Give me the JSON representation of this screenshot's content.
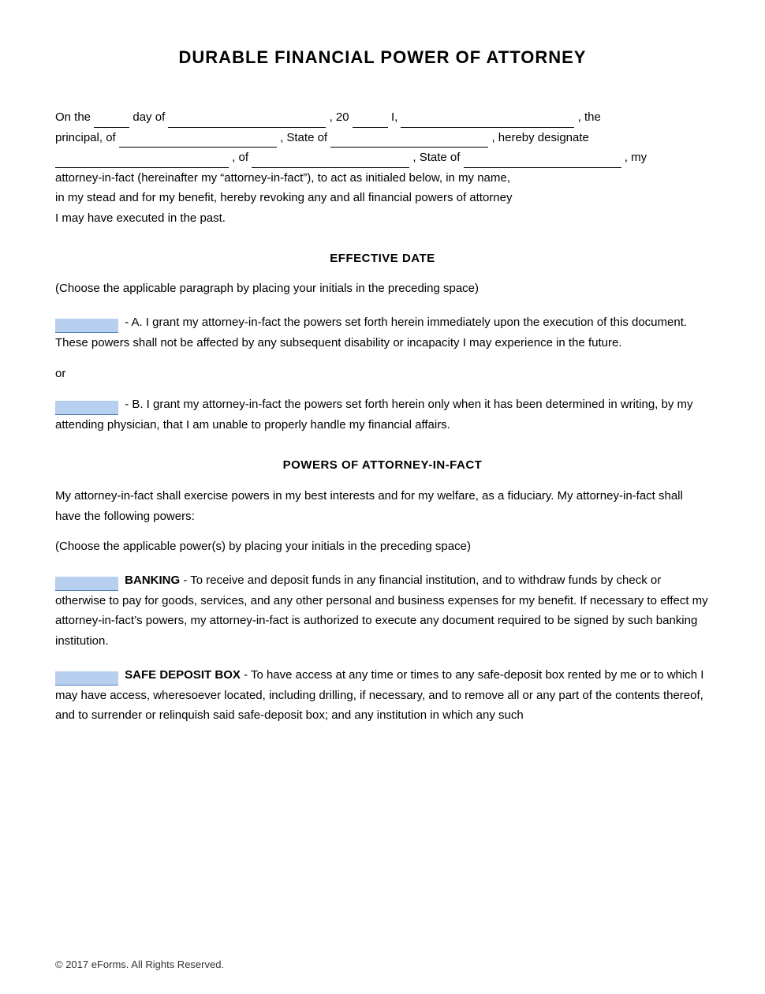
{
  "document": {
    "title": "DURABLE FINANCIAL POWER OF ATTORNEY",
    "intro": {
      "line1_prefix": "On the",
      "day_of": "day of",
      "year_prefix": ", 20",
      "I_prefix": "I,",
      "the_principal": ", the",
      "principal_of": "principal, of",
      "state_of_1": ", State of",
      "hereby_designate": ", hereby designate",
      "of_2": ", of",
      "state_of_2": ", State of",
      "my_text": ", my",
      "attorney_text": "attorney-in-fact (hereinafter my “attorney-in-fact”), to act as initialed below, in my name,",
      "stead_text": "in my stead and for my benefit, hereby revoking any and all financial powers of attorney",
      "past_text": "I may have executed in the past."
    },
    "effective_date": {
      "heading": "EFFECTIVE DATE",
      "choose_note": "(Choose the applicable paragraph by placing your initials in the preceding space)",
      "option_a": "- A. I grant my attorney-in-fact the powers set forth herein immediately upon the execution of this document. These powers shall not be affected by any subsequent disability or incapacity I may experience in the future.",
      "or_text": "or",
      "option_b": "- B. I grant my attorney-in-fact the powers set forth herein only when it has been determined in writing, by my attending physician, that I am unable to properly handle my financial affairs."
    },
    "powers_section": {
      "heading": "POWERS OF ATTORNEY-IN-FACT",
      "intro1": "My attorney-in-fact shall exercise powers in my best interests and for my welfare, as a fiduciary. My attorney-in-fact shall have the following powers:",
      "choose_note": "(Choose the applicable power(s) by placing your initials in the preceding space)",
      "banking_label": "BANKING",
      "banking_text": "- To receive and deposit funds in any financial institution, and to withdraw funds by check or otherwise to pay for goods, services, and any other personal and business expenses for my benefit.  If necessary to effect my attorney-in-fact’s powers, my attorney-in-fact is authorized to execute any document required to be signed by such banking institution.",
      "safe_deposit_label": "SAFE DEPOSIT BOX",
      "safe_deposit_text": "- To have access at any time or times to any safe-deposit box rented by me or to which I may have access, wheresoever located, including drilling, if necessary, and to remove all or any part of the contents thereof, and to surrender or relinquish said safe-deposit box; and any institution in which any such"
    },
    "footer": {
      "copyright": "© 2017 eForms. All Rights Reserved."
    }
  }
}
